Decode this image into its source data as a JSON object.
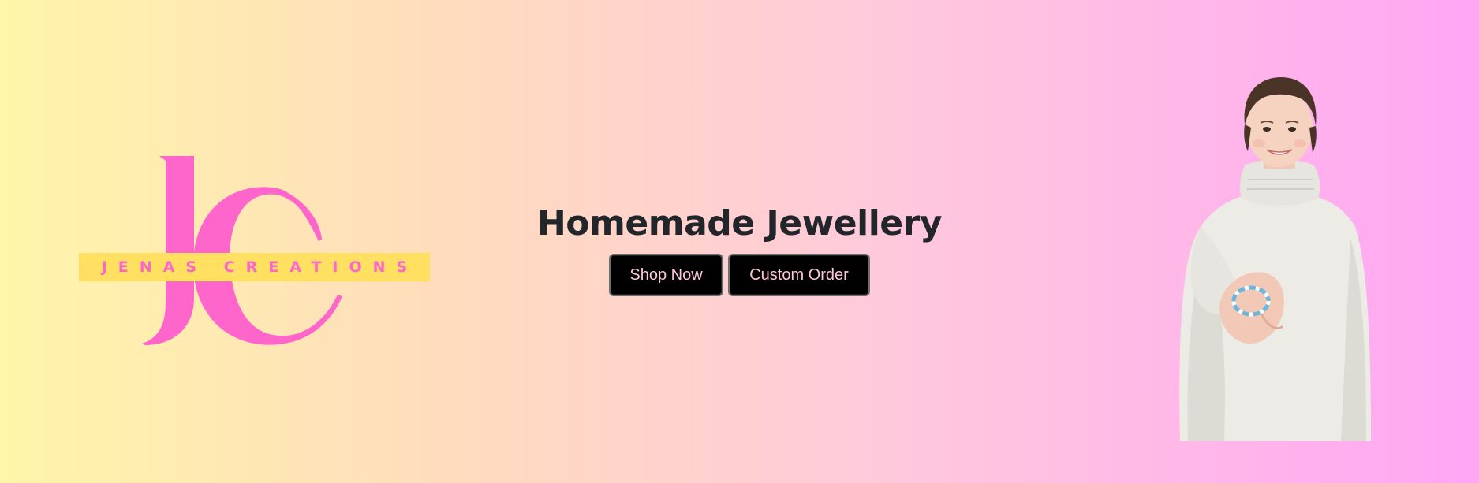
{
  "brand": {
    "monogram": "JC",
    "name": "JENAS CREATIONS",
    "colors": {
      "pink": "#ff66cc",
      "yellow": "#ffe060"
    }
  },
  "hero": {
    "title": "Homemade Jewellery",
    "buttons": {
      "shop_label": "Shop Now",
      "custom_label": "Custom Order"
    }
  },
  "photo": {
    "icon": "girl-holding-bracelet-photo"
  },
  "colors": {
    "gradient_start": "#fff6a9",
    "gradient_end": "#ffa6f4",
    "button_bg": "#000000",
    "button_text": "#ffc5dc",
    "title_text": "#222529"
  }
}
